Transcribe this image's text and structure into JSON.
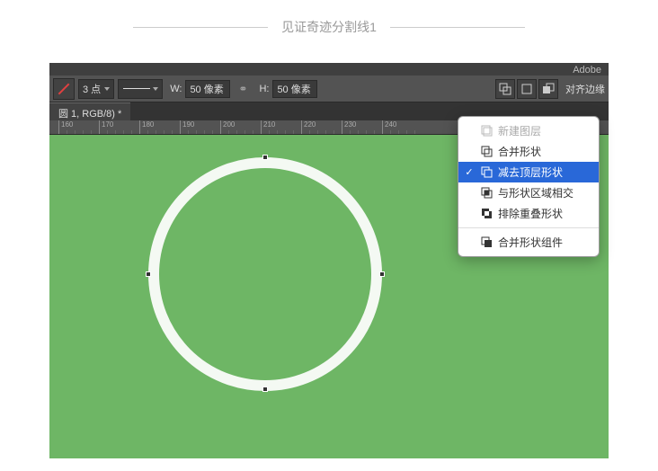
{
  "divider": {
    "text": "见证奇迹分割线1"
  },
  "titlebar": {
    "app_name": "Adobe"
  },
  "toolbar": {
    "stroke_width": "3 点",
    "w_label": "W:",
    "w_value": "50 像素",
    "h_label": "H:",
    "h_value": "50 像素",
    "align_label": "对齐边缘"
  },
  "document": {
    "tab_name": "圆 1, RGB/8) *"
  },
  "ruler": {
    "ticks": [
      "160",
      "170",
      "180",
      "190",
      "200",
      "210",
      "220",
      "230",
      "240"
    ]
  },
  "context_menu": {
    "items": [
      {
        "label": "新建图层",
        "disabled": true,
        "checked": false
      },
      {
        "label": "合并形状",
        "disabled": false,
        "checked": false
      },
      {
        "label": "减去顶层形状",
        "disabled": false,
        "checked": true,
        "selected": true
      },
      {
        "label": "与形状区域相交",
        "disabled": false,
        "checked": false
      },
      {
        "label": "排除重叠形状",
        "disabled": false,
        "checked": false
      }
    ],
    "group_item": {
      "label": "合并形状组件"
    }
  },
  "colors": {
    "canvas_bg": "#6eb665",
    "selected_bg": "#2968d8"
  }
}
